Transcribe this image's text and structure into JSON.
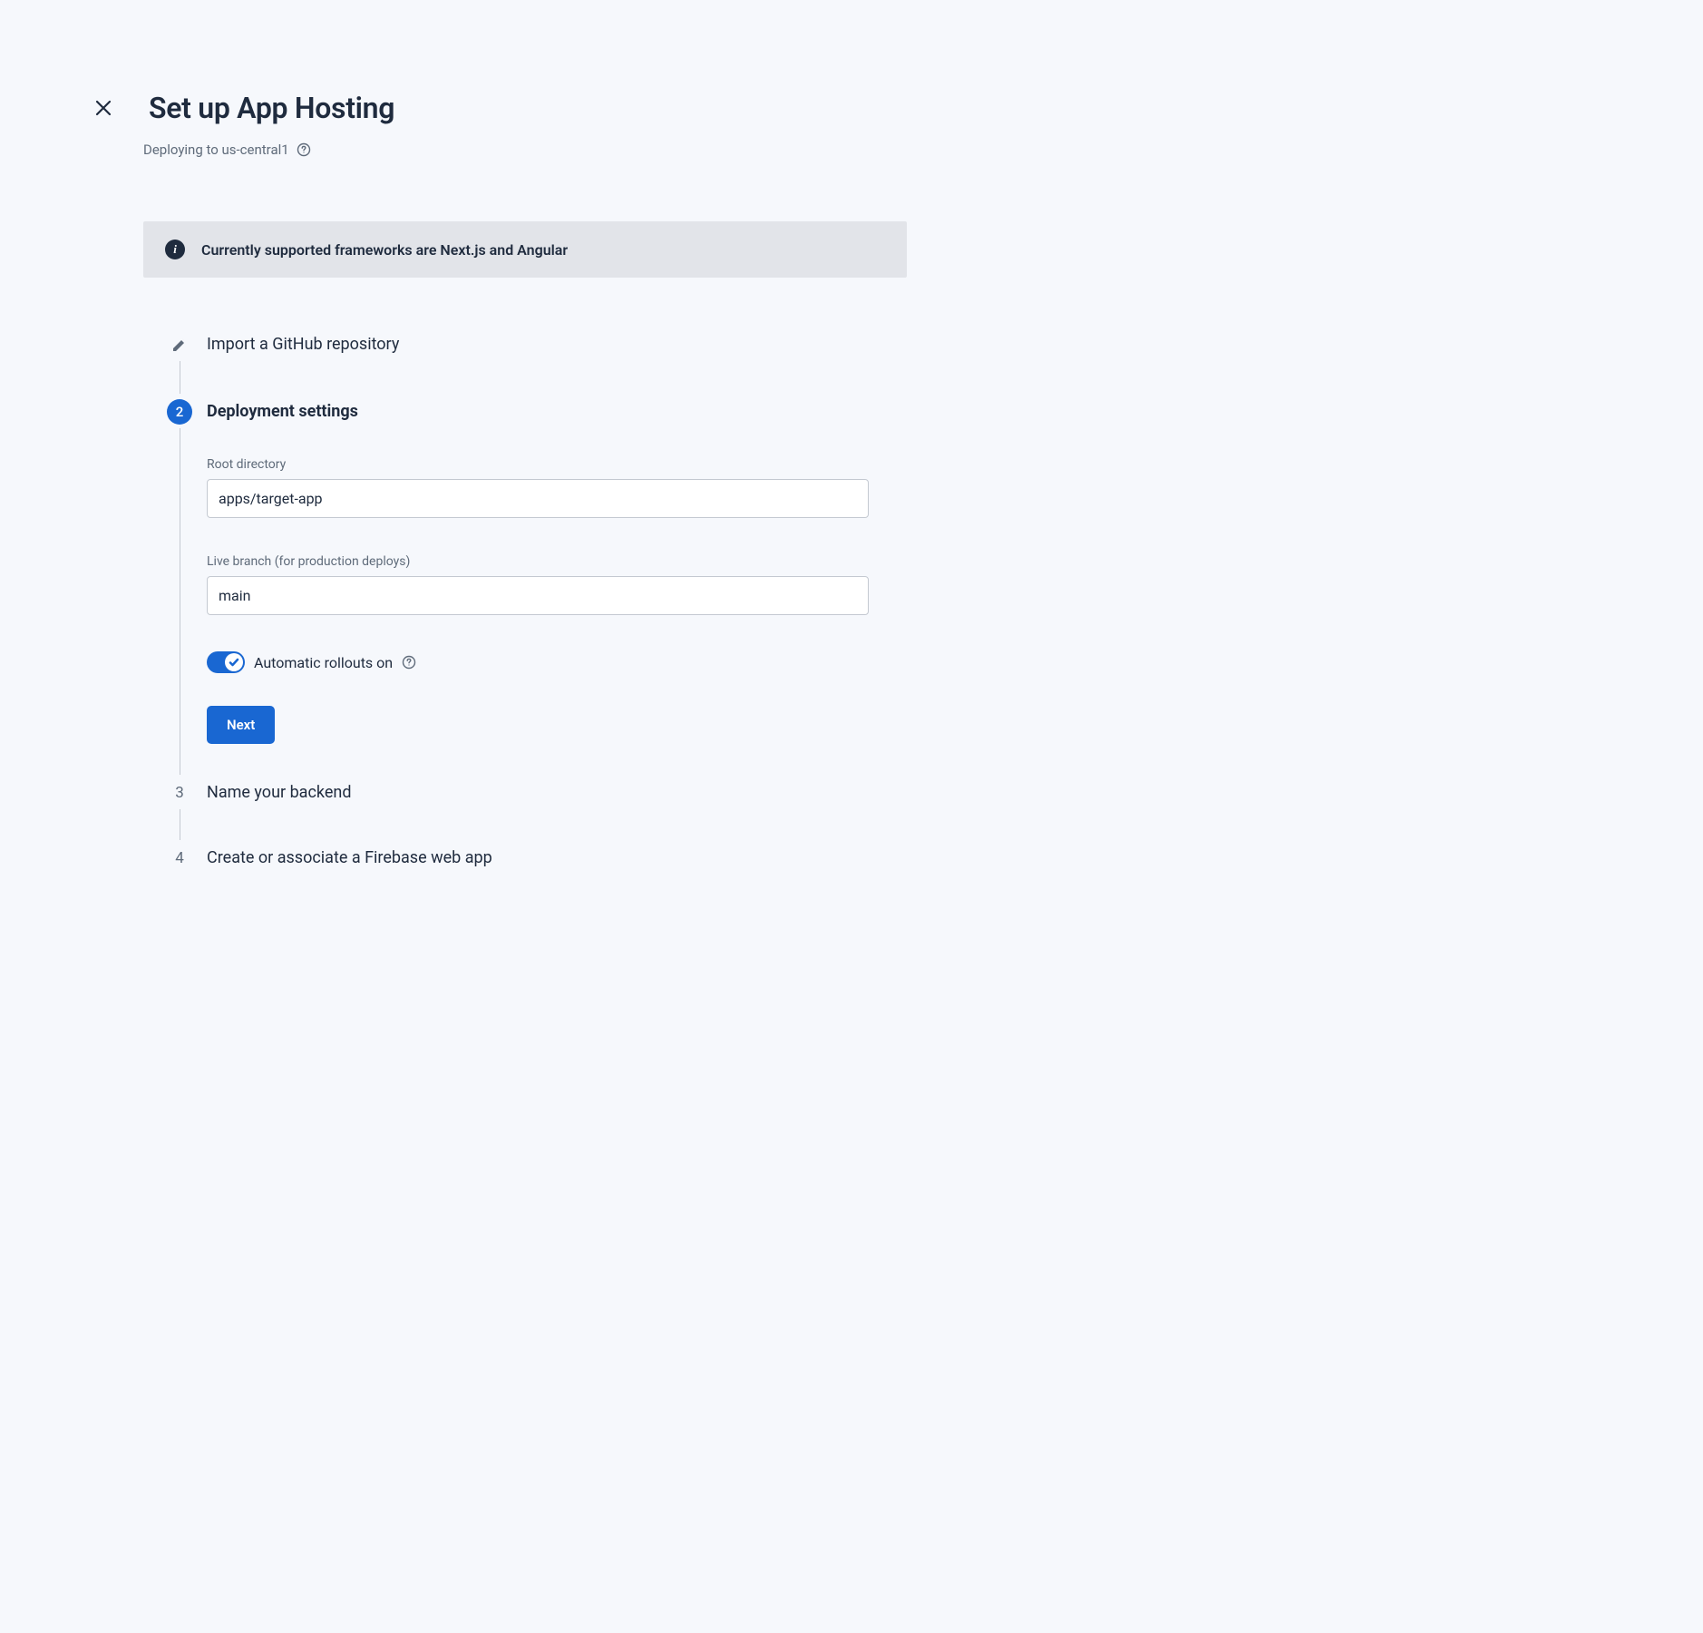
{
  "header": {
    "title": "Set up App Hosting",
    "subtitle": "Deploying to us-central1"
  },
  "banner": {
    "text": "Currently supported frameworks are Next.js and Angular"
  },
  "steps": {
    "step1": {
      "title": "Import a GitHub repository"
    },
    "step2": {
      "number": "2",
      "title": "Deployment settings",
      "root_dir_label": "Root directory",
      "root_dir_value": "apps/target-app",
      "live_branch_label": "Live branch (for production deploys)",
      "live_branch_value": "main",
      "toggle_label": "Automatic rollouts on",
      "next_button": "Next"
    },
    "step3": {
      "number": "3",
      "title": "Name your backend"
    },
    "step4": {
      "number": "4",
      "title": "Create or associate a Firebase web app"
    }
  }
}
